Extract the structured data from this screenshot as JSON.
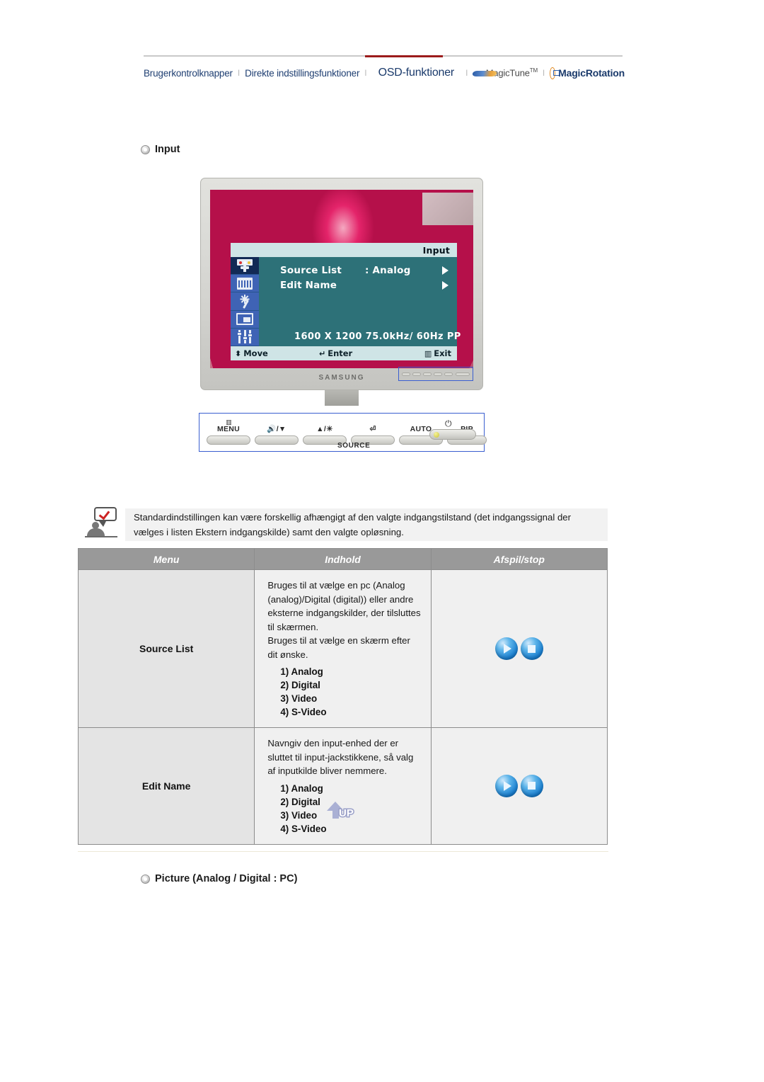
{
  "topnav": {
    "items": [
      {
        "label": "Brugerkontrolknapper",
        "active": false
      },
      {
        "label": "Direkte indstillingsfunktioner",
        "active": false
      },
      {
        "label": "OSD-funktioner",
        "active": true
      }
    ],
    "separator": "I",
    "magictune_label": "MagicTune",
    "magictune_tm": "TM",
    "magicrotation_label": "MagicRotation"
  },
  "sections": {
    "input_heading": "Input",
    "picture_heading": "Picture (Analog / Digital : PC)"
  },
  "osd": {
    "title": "Input",
    "rows": [
      {
        "label": "Source List",
        "value": ": Analog"
      },
      {
        "label": "Edit Name",
        "value": ""
      }
    ],
    "info": "1600 X 1200   75.0kHz/   60Hz  PP",
    "footer": {
      "move": "Move",
      "enter": "Enter",
      "exit": "Exit"
    }
  },
  "monitor": {
    "brand": "SAMSUNG"
  },
  "controls": {
    "menu": "MENU",
    "down": "/▼",
    "up": "▲/",
    "enter": "",
    "auto": "AUTO",
    "pip": "PIP",
    "source": "SOURCE",
    "power": "⏻"
  },
  "note": {
    "text": "Standardindstillingen kan være forskellig afhængigt af den valgte indgangstilstand (det indgangssignal der vælges i listen Ekstern indgangskilde) samt den valgte opløsning."
  },
  "table": {
    "headers": [
      "Menu",
      "Indhold",
      "Afspil/stop"
    ],
    "rows": [
      {
        "menu": "Source List",
        "description": "Bruges til at vælge en pc (Analog (analog)/Digital (digital)) eller andre eksterne indgangskilder, der tilsluttes til skærmen.\nBruges til at vælge en skærm efter dit ønske.",
        "options": [
          "1) Analog",
          "2) Digital",
          "3) Video",
          "4) S-Video"
        ]
      },
      {
        "menu": "Edit Name",
        "description": "Navngiv den input-enhed der er sluttet til input-jackstikkene, så valg af inputkilde bliver nemmere.",
        "options": [
          "1) Analog",
          "2) Digital",
          "3) Video",
          "4) S-Video"
        ]
      }
    ]
  },
  "up_button": {
    "label": "UP"
  },
  "colors": {
    "accent_red": "#9c1b1b",
    "nav_blue": "#1f3f72",
    "table_header_gray": "#999999",
    "osd_teal": "#2d7178",
    "osd_title_bg": "#cfe4e6",
    "orb_blue": "#1a7fd0"
  }
}
